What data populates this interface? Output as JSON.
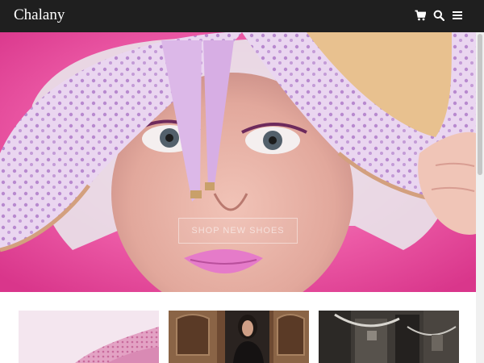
{
  "header": {
    "brand": "Chalany",
    "icons": [
      "cart-icon",
      "search-icon",
      "menu-icon"
    ]
  },
  "hero": {
    "button_label": "SHOP NEW SHOES",
    "background_color": "#e64597"
  },
  "colors": {
    "topbar": "#1f1f1f",
    "accent_pink": "#e64597"
  },
  "products": [
    {
      "image": "pink-shoe-photo"
    },
    {
      "image": "woman-in-doorway-photo"
    },
    {
      "image": "workshop-photo"
    }
  ]
}
